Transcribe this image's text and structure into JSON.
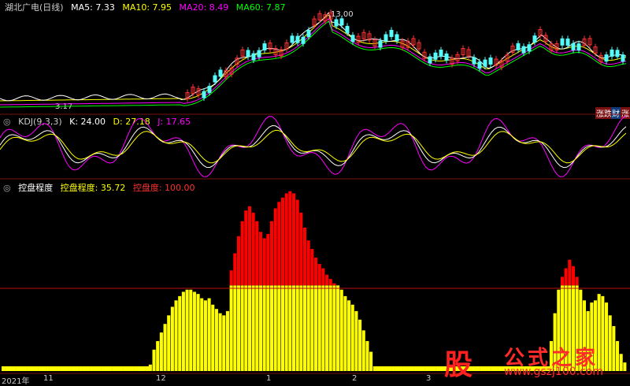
{
  "price_panel": {
    "title": "湖北广电(日线)",
    "ma5_label": "MA5:",
    "ma5_value": "7.33",
    "ma10_label": "MA10:",
    "ma10_value": "7.95",
    "ma20_label": "MA20:",
    "ma20_value": "8.49",
    "ma60_label": "MA60:",
    "ma60_value": "7.87",
    "high_marker": "13.00",
    "low_marker": "3.17",
    "corner_buttons": [
      "涨跌",
      "财",
      "涨"
    ],
    "colors": {
      "ma5": "#ffffff",
      "ma10": "#ffff00",
      "ma20": "#ff00ff",
      "ma60": "#00ff00",
      "up": "#ff3232",
      "down": "#54fcfc"
    }
  },
  "kdj_panel": {
    "title": "KDJ(9,3,3)",
    "k_label": "K:",
    "k_value": "24.00",
    "d_label": "D:",
    "d_value": "27.18",
    "j_label": "J:",
    "j_value": "17.65",
    "colors": {
      "k": "#ffffff",
      "d": "#ffff00",
      "j": "#ff00ff"
    }
  },
  "control_panel": {
    "title": "控盘程度",
    "cd_label": "控盘程度:",
    "cd_value": "35.72",
    "kp_label": "控盘度:",
    "kp_value": "100.00",
    "colors": {
      "label": "#ffffff",
      "cd": "#ffff00",
      "kp": "#ff3030"
    }
  },
  "x_axis": {
    "labels": [
      "2021年",
      "11",
      "12",
      "1",
      "2",
      "3"
    ]
  },
  "watermark": {
    "logo": "股",
    "text": "公式之家",
    "url": "www.gszj100.com"
  },
  "chart_data": {
    "type": "bar",
    "title": "控盘程度",
    "series": [
      {
        "name": "控盘程度",
        "color": "#ffff00",
        "values": [
          0,
          0,
          0,
          0,
          0,
          0,
          0,
          0,
          0,
          0,
          0,
          0,
          0,
          0,
          0,
          0,
          0,
          0,
          0,
          0,
          0,
          0,
          0,
          0,
          0,
          0,
          0,
          0,
          0,
          0,
          0,
          0,
          0,
          0,
          0,
          0,
          0,
          0,
          0,
          0,
          3,
          10,
          14,
          18,
          22,
          26,
          30,
          33,
          35,
          37,
          38,
          38,
          37,
          36,
          34,
          33,
          34,
          31,
          29,
          27,
          26,
          28,
          47,
          55,
          63,
          70,
          75,
          77,
          74,
          70,
          65,
          62,
          64,
          70,
          76,
          79,
          81,
          83,
          84,
          83,
          80,
          74,
          67,
          61,
          57,
          53,
          50,
          48,
          45,
          43,
          41,
          40,
          38,
          35,
          33,
          31,
          28,
          24,
          19,
          14,
          9,
          0,
          0,
          0,
          0,
          0,
          0,
          0,
          0,
          0,
          0,
          0,
          0,
          0,
          0,
          0,
          0,
          0,
          0,
          0,
          0,
          0,
          0,
          0,
          0,
          0,
          0,
          0,
          0,
          0,
          0,
          0,
          0,
          0,
          0,
          0,
          0,
          0,
          0,
          0,
          0,
          0,
          0,
          0,
          0,
          0,
          0,
          0,
          0,
          14,
          27,
          38,
          44,
          48,
          52,
          49,
          44,
          38,
          33,
          28,
          32,
          33,
          36,
          35,
          32,
          26,
          21,
          14,
          8,
          4
        ]
      }
    ],
    "threshold": 40,
    "ylim": [
      0,
      85
    ]
  }
}
